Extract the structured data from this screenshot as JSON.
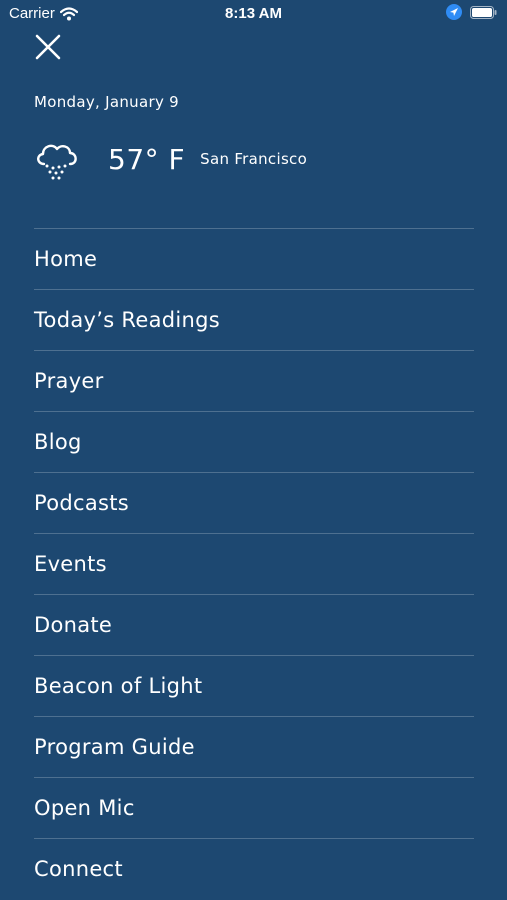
{
  "status_bar": {
    "carrier": "Carrier",
    "time": "8:13 AM",
    "icons": [
      "wifi-icon",
      "location-arrow-icon",
      "battery-icon"
    ]
  },
  "header": {
    "close_icon": "close-icon",
    "date": "Monday, January 9",
    "weather": {
      "icon": "rain-cloud-icon",
      "temperature": "57° F",
      "city": "San Francisco"
    }
  },
  "menu": {
    "items": [
      {
        "label": "Home"
      },
      {
        "label": "Today’s Readings"
      },
      {
        "label": "Prayer"
      },
      {
        "label": "Blog"
      },
      {
        "label": "Podcasts"
      },
      {
        "label": "Events"
      },
      {
        "label": "Donate"
      },
      {
        "label": "Beacon of Light"
      },
      {
        "label": "Program Guide"
      },
      {
        "label": "Open Mic"
      },
      {
        "label": "Connect"
      }
    ]
  },
  "colors": {
    "background": "#1d4871",
    "text": "#ffffff",
    "location_accent": "#2f8cf5"
  }
}
